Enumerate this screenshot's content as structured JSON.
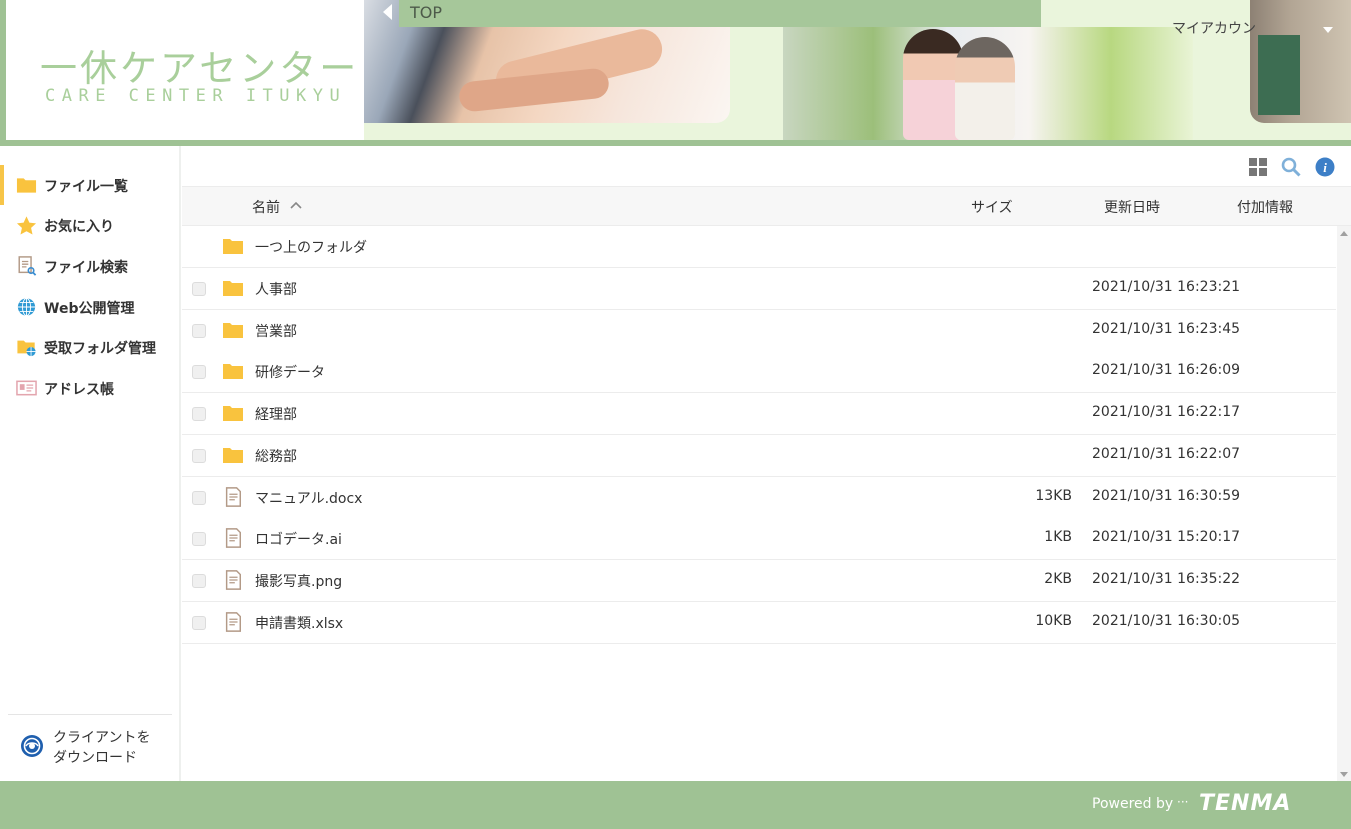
{
  "header": {
    "logo_title": "一休ケアセンター",
    "logo_subtitle": "CARE CENTER ITUKYU",
    "breadcrumb": "TOP",
    "account_menu": "マイアカウン"
  },
  "sidebar": {
    "items": [
      {
        "label": "ファイル一覧",
        "icon": "folder-icon"
      },
      {
        "label": "お気に入り",
        "icon": "star-icon"
      },
      {
        "label": "ファイル検索",
        "icon": "file-search-icon"
      },
      {
        "label": "Web公開管理",
        "icon": "globe-icon"
      },
      {
        "label": "受取フォルダ管理",
        "icon": "receive-folder-icon"
      },
      {
        "label": "アドレス帳",
        "icon": "address-book-icon"
      }
    ],
    "download_label": "クライアントを ダウンロード"
  },
  "table": {
    "columns": {
      "name": "名前",
      "size": "サイズ",
      "updated": "更新日時",
      "extra": "付加情報"
    },
    "parent_folder": "一つ上のフォルダ",
    "rows": [
      {
        "name": "人事部",
        "type": "folder",
        "size": "",
        "updated": "2021/10/31 16:23:21"
      },
      {
        "name": "営業部",
        "type": "folder",
        "size": "",
        "updated": "2021/10/31 16:23:45"
      },
      {
        "name": "研修データ",
        "type": "folder",
        "size": "",
        "updated": "2021/10/31 16:26:09"
      },
      {
        "name": "経理部",
        "type": "folder",
        "size": "",
        "updated": "2021/10/31 16:22:17"
      },
      {
        "name": "総務部",
        "type": "folder",
        "size": "",
        "updated": "2021/10/31 16:22:07"
      },
      {
        "name": "マニュアル.docx",
        "type": "file",
        "size": "13KB",
        "updated": "2021/10/31 16:30:59"
      },
      {
        "name": "ロゴデータ.ai",
        "type": "file",
        "size": "1KB",
        "updated": "2021/10/31 15:20:17"
      },
      {
        "name": "撮影写真.png",
        "type": "file",
        "size": "2KB",
        "updated": "2021/10/31 16:35:22"
      },
      {
        "name": "申請書類.xlsx",
        "type": "file",
        "size": "10KB",
        "updated": "2021/10/31 16:30:05"
      }
    ]
  },
  "footer": {
    "powered_by": "Powered by",
    "dots": "···",
    "brand": "TENMA"
  },
  "colors": {
    "accent_green": "#9fc294",
    "folder_yellow": "#f9c33e",
    "active_marker": "#f7c548"
  }
}
